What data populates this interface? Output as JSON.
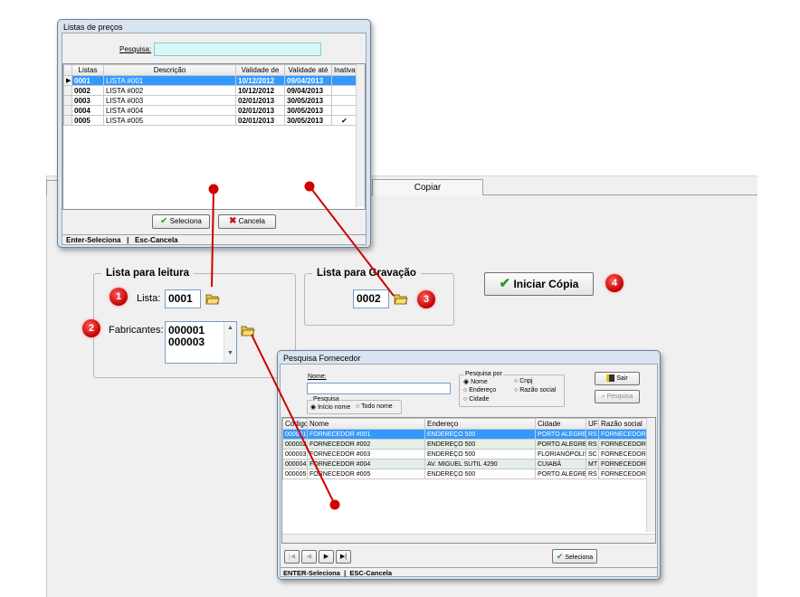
{
  "main": {
    "tab_label": "Copiar",
    "read_group": {
      "legend": "Lista para leitura",
      "lista_label": "Lista:",
      "lista_value": "0001",
      "fabricantes_label": "Fabricantes:",
      "fabricantes_values": [
        "000001",
        "000003"
      ]
    },
    "write_group": {
      "legend": "Lista para Gravação",
      "lista_value": "0002"
    },
    "start_button": "Iniciar Cópia",
    "badges": [
      "1",
      "2",
      "3",
      "4"
    ]
  },
  "price_lists": {
    "title": "Listas de preços",
    "search_label": "Pesquisa:",
    "search_value": "",
    "columns": [
      "Listas",
      "Descrição",
      "Validade de",
      "Validade até",
      "Inativa"
    ],
    "rows": [
      {
        "code": "0001",
        "desc": "LISTA #001",
        "from": "10/12/2012",
        "to": "09/04/2013",
        "inactive": ""
      },
      {
        "code": "0002",
        "desc": "LISTA #002",
        "from": "10/12/2012",
        "to": "09/04/2013",
        "inactive": ""
      },
      {
        "code": "0003",
        "desc": "LISTA #003",
        "from": "02/01/2013",
        "to": "30/05/2013",
        "inactive": ""
      },
      {
        "code": "0004",
        "desc": "LISTA #004",
        "from": "02/01/2013",
        "to": "30/05/2013",
        "inactive": ""
      },
      {
        "code": "0005",
        "desc": "LISTA #005",
        "from": "02/01/2013",
        "to": "30/05/2013",
        "inactive": "✔"
      }
    ],
    "select_button": "Seleciona",
    "cancel_button": "Cancela",
    "status": "Enter-Seleciona   |   Esc-Cancela"
  },
  "supplier_search": {
    "title": "Pesquisa Fornecedor",
    "name_label": "Nome:",
    "name_value": "",
    "search_by_legend": "Pesquisa por",
    "search_by_options": [
      "Nome",
      "Cnpj",
      "Endereço",
      "Razão social",
      "Cidade"
    ],
    "search_by_selected": "Nome",
    "search_legend": "Pesquisa",
    "search_options": [
      "Início nome",
      "Todo nome"
    ],
    "search_selected": "Início nome",
    "exit_button": "Sair",
    "search_button": "Pesquisa",
    "columns": [
      "Código",
      "Nome",
      "Endereço",
      "Cidade",
      "UF",
      "Razão social"
    ],
    "rows": [
      {
        "code": "000001",
        "name": "FORNECEDOR #001",
        "addr": "ENDEREÇO 500",
        "city": "PORTO ALEGRE",
        "uf": "RS",
        "razao": "FORNECEDOR TI"
      },
      {
        "code": "000002",
        "name": "FORNECEDOR #002",
        "addr": "ENDEREÇO 500",
        "city": "PORTO ALEGRE",
        "uf": "RS",
        "razao": "FORNECEDOR TI"
      },
      {
        "code": "000003",
        "name": "FORNECEDOR #003",
        "addr": "ENDEREÇO 500",
        "city": "FLORIANÓPOLIS",
        "uf": "SC",
        "razao": "FORNECEDOR TI"
      },
      {
        "code": "000004",
        "name": "FORNECEDOR #004",
        "addr": "AV. MIGUEL SUTIL 4290",
        "city": "CUIABÁ",
        "uf": "MT",
        "razao": "FORNECEDOR TI"
      },
      {
        "code": "000005",
        "name": "FORNECEDOR #005",
        "addr": "ENDEREÇO 500",
        "city": "PORTO ALEGRE",
        "uf": "RS",
        "razao": "FORNECEDOR TI"
      }
    ],
    "select_button": "Seleciona",
    "status": "ENTER-Seleciona  |  ESC-Cancela"
  },
  "colors": {
    "selection": "#3399ff",
    "badge": "#d00000",
    "annotation_line": "#d00000",
    "check": "#2a9a2a",
    "cross": "#cc1111"
  }
}
